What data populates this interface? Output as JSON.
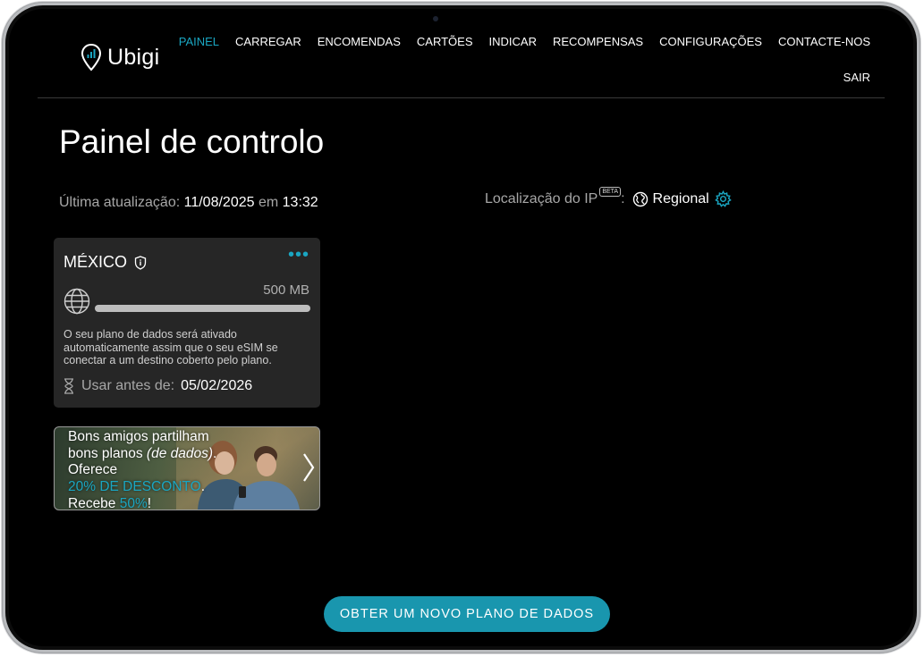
{
  "app": {
    "brand": "Ubigi"
  },
  "nav": {
    "items": [
      "PAINEL",
      "CARREGAR",
      "ENCOMENDAS",
      "CARTÕES",
      "INDICAR",
      "RECOMPENSAS",
      "CONFIGURAÇÕES",
      "CONTACTE-NOS"
    ],
    "logout": "SAIR",
    "active_index": 0
  },
  "page": {
    "title": "Painel de controlo"
  },
  "last_update": {
    "label": "Última atualização:",
    "date": "11/08/2025",
    "connector": "em",
    "time": "13:32"
  },
  "ip_location": {
    "label": "Localização do IP",
    "badge": "BETA",
    "separator": ":",
    "value": "Regional"
  },
  "plan": {
    "country": "MÉXICO",
    "data_amount": "500 MB",
    "description": "O seu plano de dados será ativado automaticamente assim que o seu eSIM se conectar a um destino coberto pelo plano.",
    "use_before_label": "Usar antes de:",
    "use_before_date": "05/02/2026"
  },
  "promo": {
    "line1": "Bons amigos partilham",
    "line2a": "bons planos ",
    "line2b": "(de dados)",
    "line2c": ".",
    "line3": "Oferece",
    "line4a": "20% DE DESCONTO",
    "line4b": ".",
    "line5a": "Recebe ",
    "line5b": "50%",
    "line5c": "!"
  },
  "cta": {
    "label": "OBTER UM NOVO PLANO DE DADOS"
  },
  "colors": {
    "accent": "#1aa6c2",
    "button": "#1996ae",
    "card": "#262626",
    "background": "#000000"
  }
}
